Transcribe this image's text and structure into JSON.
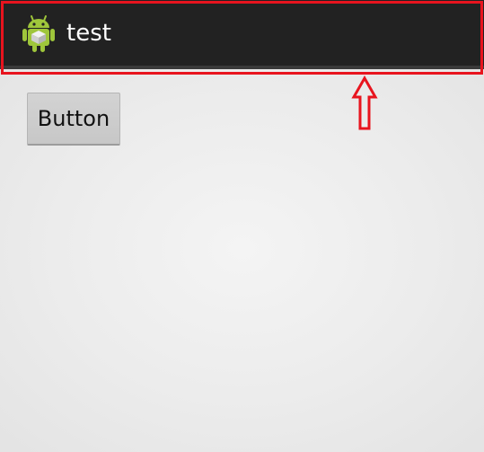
{
  "action_bar": {
    "app_icon": "android-robot-icon",
    "title": "test",
    "background_color": "#222222"
  },
  "main": {
    "button_label": "Button"
  },
  "annotation": {
    "color": "#e8141e",
    "shapes": [
      "highlight-rectangle",
      "up-arrow"
    ]
  }
}
